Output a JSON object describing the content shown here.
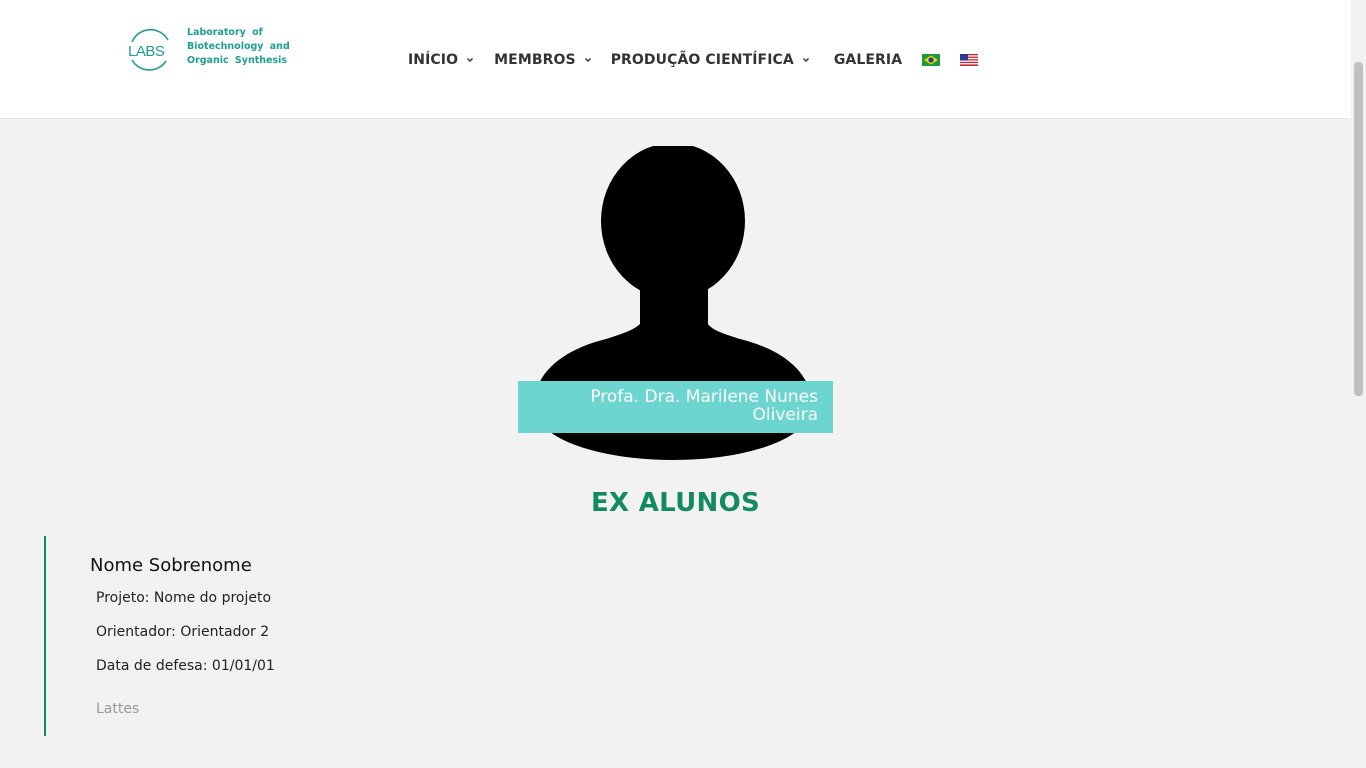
{
  "header": {
    "logo": {
      "mark_text": "LABS",
      "lines": [
        "Laboratory of",
        "Biotechnology and",
        "Organic Synthesis"
      ]
    },
    "nav": {
      "inicio": "INÍCIO",
      "membros": "MEMBROS",
      "producao": "PRODUÇÃO CIENTÍFICA",
      "galeria": "GALERIA"
    },
    "flags": [
      "brazil-flag-icon",
      "usa-flag-icon"
    ]
  },
  "professor": {
    "name_line1": "Profa. Dra. Marilene Nunes",
    "name_line2": "Oliveira"
  },
  "section": {
    "title": "EX ALUNOS"
  },
  "alumni": [
    {
      "name": "Nome Sobrenome",
      "projeto": "Projeto: Nome do projeto",
      "orientador": "Orientador: Orientador 2",
      "defesa": "Data de defesa: 01/01/01",
      "lattes": "Lattes"
    }
  ],
  "colors": {
    "accent_teal": "#1e9e95",
    "name_box": "#6dd5cf",
    "section_green": "#128a63",
    "background": "#f2f2f2"
  }
}
